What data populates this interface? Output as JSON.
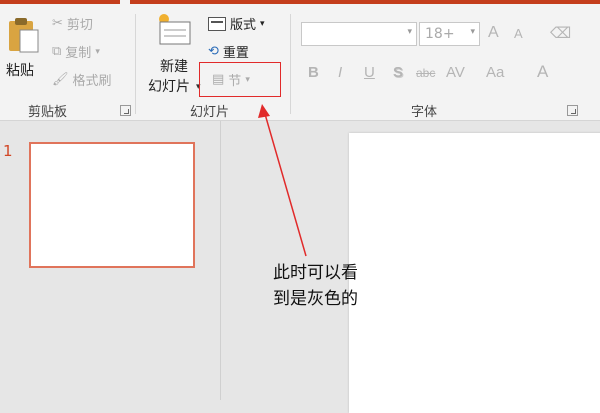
{
  "ribbon": {
    "clipboard": {
      "paste_label": "粘贴",
      "cut_label": "剪切",
      "copy_label": "复制",
      "format_painter_label": "格式刷",
      "group_label": "剪贴板"
    },
    "slides": {
      "new_slide_line1": "新建",
      "new_slide_line2": "幻灯片",
      "layout_label": "版式",
      "reset_label": "重置",
      "section_label": "节",
      "group_label": "幻灯片"
    },
    "font": {
      "font_name_value": "",
      "font_size_value": "18+",
      "bold": "B",
      "italic": "I",
      "underline": "U",
      "shadow": "S",
      "strike": "abc",
      "spacing": "AV",
      "case": "Aa",
      "color": "A",
      "grow": "A",
      "shrink": "A",
      "group_label": "字体"
    }
  },
  "thumbnails": {
    "slide_number": "1"
  },
  "annotation": {
    "text_line1": "此时可以看",
    "text_line2": "到是灰色的"
  },
  "colors": {
    "accent": "#c43e1c",
    "highlight_box": "#e12a2a",
    "thumb_border": "#e0745b"
  }
}
